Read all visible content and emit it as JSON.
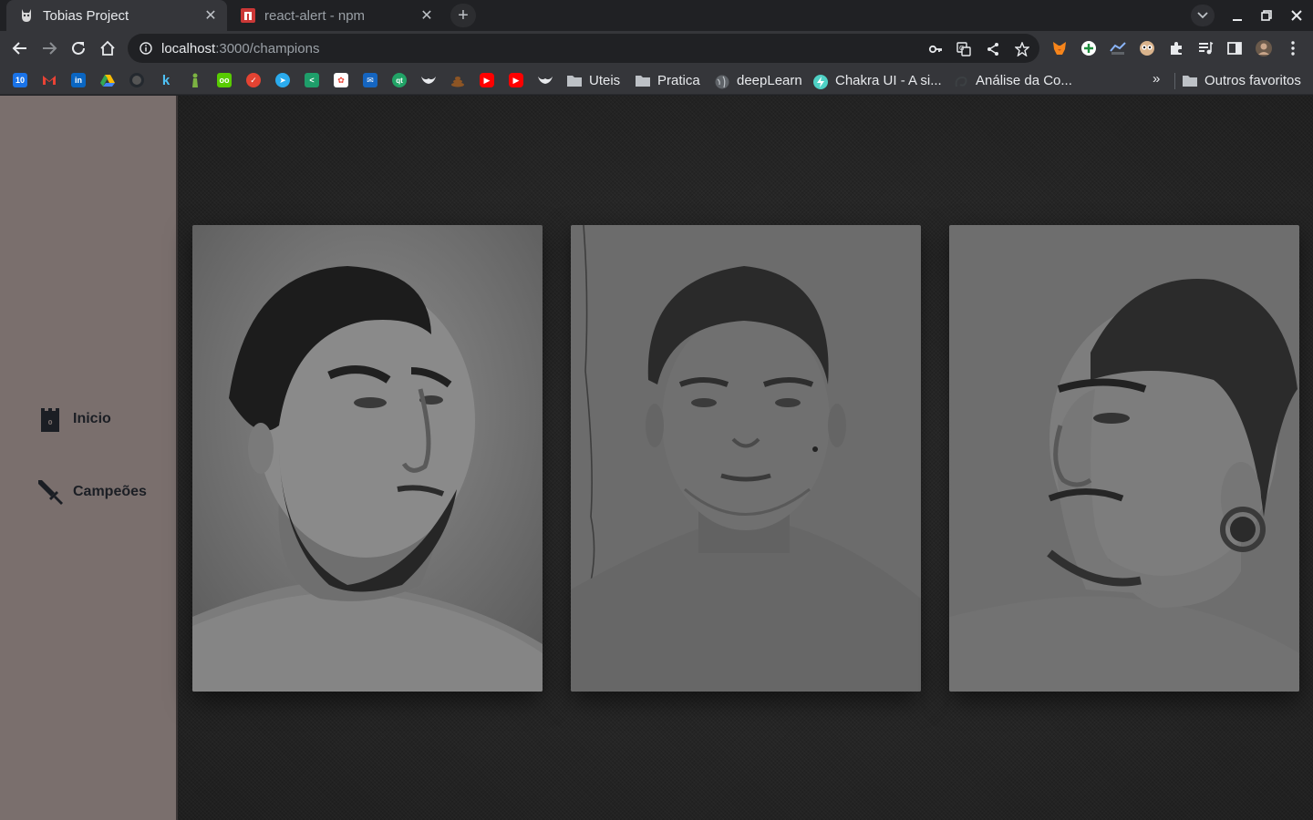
{
  "browser": {
    "tabs": [
      {
        "title": "Tobias Project",
        "active": true,
        "favicon": "batman-mask-icon"
      },
      {
        "title": "react-alert - npm",
        "active": false,
        "favicon": "npm-icon"
      }
    ],
    "address_bar": {
      "host": "localhost",
      "path": ":3000/champions"
    },
    "bookmarks": {
      "icons": [
        "calendar-icon",
        "gmail-icon",
        "linkedin-icon",
        "drive-icon",
        "github-icon",
        "klickpages-icon",
        "figure-icon",
        "duolingo-icon",
        "todoist-icon",
        "telegram-icon",
        "dictionary-icon",
        "photos-icon",
        "mail-icon",
        "qt-icon",
        "batman-icon",
        "poop-icon",
        "youtube-icon",
        "youtube-icon",
        "batman-icon"
      ],
      "folders": [
        "Uteis",
        "Pratica"
      ],
      "links": [
        "deepLearn",
        "Chakra UI - A si...",
        "Análise da Co..."
      ],
      "other_folder": "Outros favoritos",
      "overflow": "»"
    },
    "colors": {
      "frame": "#202124",
      "toolbar": "#35363a"
    }
  },
  "app": {
    "sidebar": {
      "items": [
        {
          "label": "Inicio",
          "icon": "tower-icon"
        },
        {
          "label": "Campeões",
          "icon": "sword-icon"
        }
      ],
      "color": "#7a6f6d"
    },
    "champions": [
      {
        "photo": "portrait-bearded-man-three-quarter-profile"
      },
      {
        "photo": "portrait-young-man-front-facing"
      },
      {
        "photo": "portrait-man-profile-with-ear-gauge"
      }
    ]
  }
}
